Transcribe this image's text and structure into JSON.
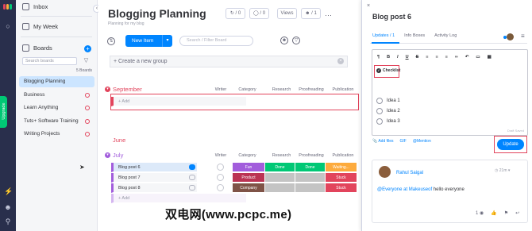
{
  "nav": {
    "upgrade_label": "Upgrade"
  },
  "sidebar": {
    "inbox": "Inbox",
    "my_week": "My Week",
    "boards_title": "Boards",
    "search_placeholder": "Search boards",
    "board_count": "5 Boards",
    "boards": [
      {
        "label": "Blogging Planning",
        "active": true
      },
      {
        "label": "Business",
        "active": false
      },
      {
        "label": "Learn Anything",
        "active": false
      },
      {
        "label": "Tuts+ Software Training",
        "active": false
      },
      {
        "label": "Writing Projects",
        "active": false
      }
    ]
  },
  "board": {
    "title": "Blogging Planning",
    "subtitle": "Planning for my blog",
    "activity_count": "/ 0",
    "updates_count": "/ 0",
    "views_label": "Views",
    "members_count": "/ 1",
    "new_item_label": "New Item",
    "search_placeholder": "Search / Filter Board",
    "create_group_placeholder": "+ Create a new group",
    "columns": [
      "Writer",
      "Category",
      "Research",
      "Proofreading",
      "Publication"
    ],
    "add_label": "+ Add",
    "groups": [
      {
        "name": "September",
        "color": "#e2445c"
      },
      {
        "name": "June",
        "color": "#e2445c"
      },
      {
        "name": "July",
        "color": "#a25ddc"
      }
    ],
    "july_items": [
      {
        "name": "Blog post 6",
        "category": "Fun",
        "category_color": "#a25ddc",
        "research": "Done",
        "research_color": "#00c875",
        "proofreading": "Done",
        "proofreading_color": "#00c875",
        "publication": "Waiting...",
        "publication_color": "#fdab3d"
      },
      {
        "name": "Blog post 7",
        "category": "Product",
        "category_color": "#bb3354",
        "research": "",
        "research_color": "#c4c4c4",
        "proofreading": "",
        "proofreading_color": "#c4c4c4",
        "publication": "Stuck",
        "publication_color": "#e2445c"
      },
      {
        "name": "Blog post 8",
        "category": "Company",
        "category_color": "#7f5347",
        "research": "",
        "research_color": "#c4c4c4",
        "proofreading": "",
        "proofreading_color": "#c4c4c4",
        "publication": "Stuck",
        "publication_color": "#e2445c"
      }
    ]
  },
  "panel": {
    "title": "Blog post 6",
    "tabs": [
      "Updates / 1",
      "Info Boxes",
      "Activity Log"
    ],
    "checklist_label": "Checklist",
    "ideas": [
      "Idea 1",
      "Idea 2",
      "Idea 3"
    ],
    "draft_label": "Draft Saved",
    "add_files": "Add files",
    "gif": "GIF",
    "mention": "@Mention",
    "update_button": "Update",
    "update_card": {
      "author": "Rahul Saigal",
      "time": "21m",
      "mention": "@Everyone at Makeuseof",
      "message": " hello everyone",
      "views": "1"
    }
  },
  "watermark": "双电网(www.pcpc.me)"
}
